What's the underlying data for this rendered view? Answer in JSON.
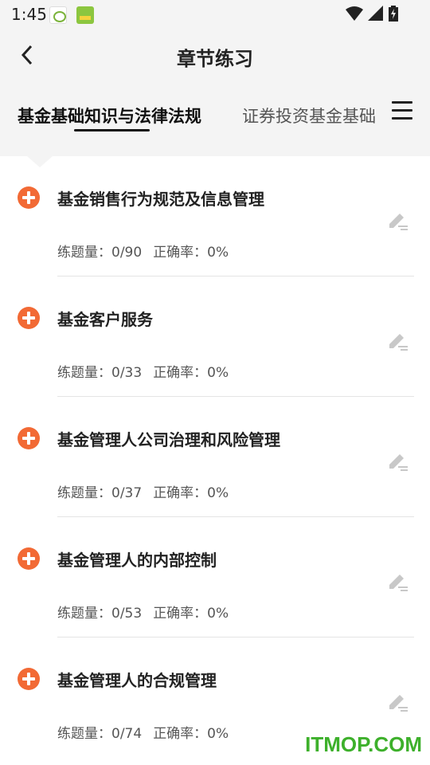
{
  "status": {
    "time": "1:45"
  },
  "header": {
    "title": "章节练习"
  },
  "tabs": [
    {
      "label": "基金基础知识与法律法规",
      "active": true
    },
    {
      "label": "证券投资基金基础",
      "active": false
    }
  ],
  "colors": {
    "accent": "#f26a35",
    "watermark": "#3db02b"
  },
  "chapters": [
    {
      "title": "基金销售行为规范及信息管理",
      "count": "练题量：0/90",
      "accuracy": "正确率：0%"
    },
    {
      "title": "基金客户服务",
      "count": "练题量：0/33",
      "accuracy": "正确率：0%"
    },
    {
      "title": "基金管理人公司治理和风险管理",
      "count": "练题量：0/37",
      "accuracy": "正确率：0%"
    },
    {
      "title": "基金管理人的内部控制",
      "count": "练题量：0/53",
      "accuracy": "正确率：0%"
    },
    {
      "title": "基金管理人的合规管理",
      "count": "练题量：0/74",
      "accuracy": "正确率：0%"
    }
  ],
  "watermark": "ITMOP.COM"
}
